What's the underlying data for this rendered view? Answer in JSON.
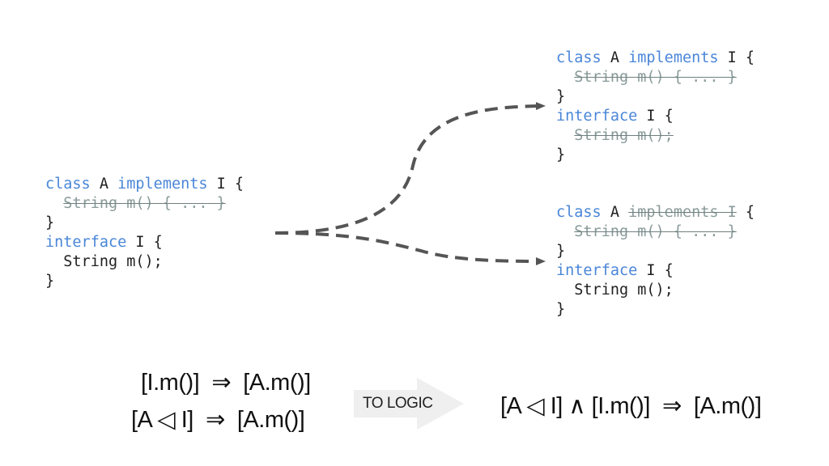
{
  "code_blocks": {
    "source": [
      [
        {
          "t": "class",
          "s": "kw"
        },
        {
          "t": " A "
        },
        {
          "t": "implements",
          "s": "kw"
        },
        {
          "t": " I {"
        }
      ],
      [
        {
          "t": "  "
        },
        {
          "t": "String m() { ... }",
          "s": "del"
        }
      ],
      [
        {
          "t": "}"
        }
      ],
      [
        {
          "t": "interface",
          "s": "kw"
        },
        {
          "t": " I {"
        }
      ],
      [
        {
          "t": "  String m();"
        }
      ],
      [
        {
          "t": "}"
        }
      ]
    ],
    "result_top": [
      [
        {
          "t": "class",
          "s": "kw"
        },
        {
          "t": " A "
        },
        {
          "t": "implements",
          "s": "kw"
        },
        {
          "t": " I {"
        }
      ],
      [
        {
          "t": "  "
        },
        {
          "t": "String m() { ... }",
          "s": "del"
        }
      ],
      [
        {
          "t": "}"
        }
      ],
      [
        {
          "t": "interface",
          "s": "kw"
        },
        {
          "t": " I {"
        }
      ],
      [
        {
          "t": "  "
        },
        {
          "t": "String m();",
          "s": "del"
        }
      ],
      [
        {
          "t": "}"
        }
      ]
    ],
    "result_bottom": [
      [
        {
          "t": "class",
          "s": "kw"
        },
        {
          "t": " A "
        },
        {
          "t": "implements I",
          "s": "del"
        },
        {
          "t": " {"
        }
      ],
      [
        {
          "t": "  "
        },
        {
          "t": "String m() { ... }",
          "s": "del"
        }
      ],
      [
        {
          "t": "}"
        }
      ],
      [
        {
          "t": "interface",
          "s": "kw"
        },
        {
          "t": " I {"
        }
      ],
      [
        {
          "t": "  String m();"
        }
      ],
      [
        {
          "t": "}"
        }
      ]
    ]
  },
  "formulas": {
    "left_1": "[I.m()]  ⇒  [A.m()]",
    "left_2": "[A ◁ I]  ⇒  [A.m()]",
    "right": "[A ◁ I] ∧ [I.m()]  ⇒  [A.m()]"
  },
  "arrow_label": "TO LOGIC",
  "colors": {
    "keyword": "#4a86d8",
    "deleted": "#8a9a9a",
    "arrow": "#555555",
    "logic_arrow": "#eeeeee"
  }
}
